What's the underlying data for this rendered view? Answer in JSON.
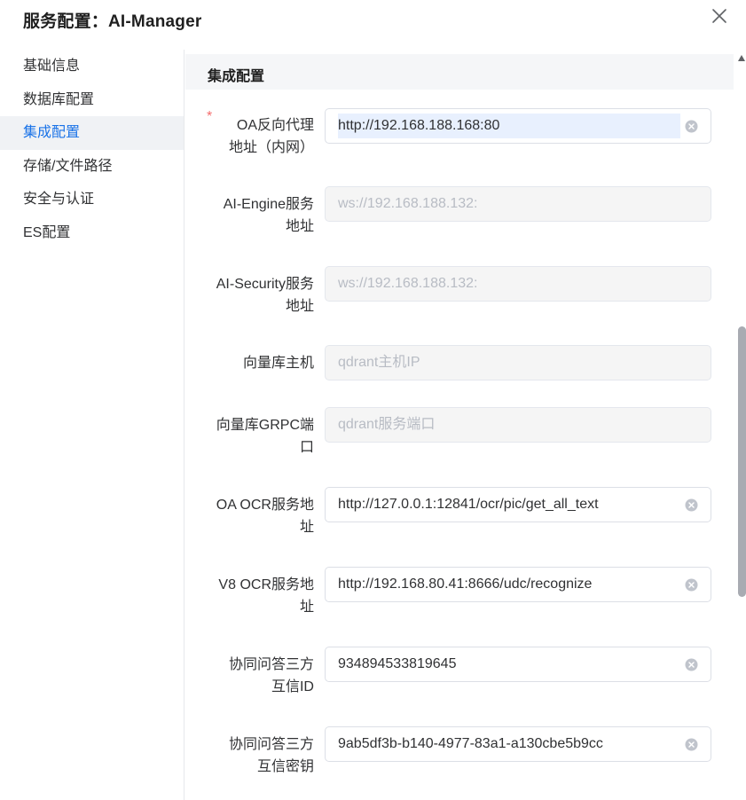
{
  "dialog": {
    "title": "服务配置：AI-Manager"
  },
  "sidebar": {
    "items": [
      {
        "label": "基础信息",
        "active": false
      },
      {
        "label": "数据库配置",
        "active": false
      },
      {
        "label": "集成配置",
        "active": true
      },
      {
        "label": "存储/文件路径",
        "active": false
      },
      {
        "label": "安全与认证",
        "active": false
      },
      {
        "label": "ES配置",
        "active": false
      }
    ]
  },
  "section": {
    "title": "集成配置"
  },
  "fields": [
    {
      "label_line1": "OA反向代理",
      "label_line2": "地址（内网）",
      "required": true,
      "value": "http://192.168.188.168:80",
      "placeholder": "",
      "disabled": false,
      "clearable": true,
      "selected": true
    },
    {
      "label_line1": "AI-Engine服务",
      "label_line2": "地址",
      "required": false,
      "value": "",
      "placeholder": "ws://192.168.188.132:",
      "disabled": true,
      "clearable": false
    },
    {
      "label_line1": "AI-Security服务",
      "label_line2": "地址",
      "required": false,
      "value": "",
      "placeholder": "ws://192.168.188.132:",
      "disabled": true,
      "clearable": false
    },
    {
      "label_line1": "向量库主机",
      "label_line2": "",
      "required": false,
      "value": "",
      "placeholder": "qdrant主机IP",
      "disabled": true,
      "clearable": false
    },
    {
      "label_line1": "向量库GRPC端",
      "label_line2": "口",
      "required": false,
      "value": "",
      "placeholder": "qdrant服务端口",
      "disabled": true,
      "clearable": false
    },
    {
      "label_line1": "OA OCR服务地",
      "label_line2": "址",
      "required": false,
      "value": "http://127.0.0.1:12841/ocr/pic/get_all_text",
      "placeholder": "",
      "disabled": false,
      "clearable": true
    },
    {
      "label_line1": "V8 OCR服务地",
      "label_line2": "址",
      "required": false,
      "value": "http://192.168.80.41:8666/udc/recognize",
      "placeholder": "",
      "disabled": false,
      "clearable": true
    },
    {
      "label_line1": "协同问答三方",
      "label_line2": "互信ID",
      "required": false,
      "value": "934894533819645",
      "placeholder": "",
      "disabled": false,
      "clearable": true
    },
    {
      "label_line1": "协同问答三方",
      "label_line2": "互信密钥",
      "required": false,
      "value": "9ab5df3b-b140-4977-83a1-a130cbe5b9cc",
      "placeholder": "",
      "disabled": false,
      "clearable": true
    }
  ],
  "icons": {
    "close": "close-icon",
    "clear": "circle-close-icon",
    "scroll_up": "triangle-up-icon"
  },
  "colors": {
    "accent": "#1a73e8",
    "required": "#f56c6c",
    "disabled_bg": "#f5f5f5"
  }
}
